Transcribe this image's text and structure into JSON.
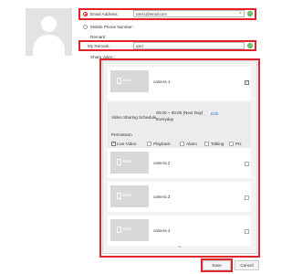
{
  "form": {
    "email_label": "Email Address:",
    "email_value": "user1@email.com",
    "phone_label": "Mobile Phone Number:",
    "remark_label": "Remark:",
    "my_remark_label": "My Remark:",
    "my_remark_value": "user",
    "share_label": "Share video :"
  },
  "cameras": [
    {
      "name": "camera 1",
      "checked": true
    },
    {
      "name": "camera 2",
      "checked": false
    },
    {
      "name": "camera 3",
      "checked": false
    },
    {
      "name": "camera 4",
      "checked": false
    }
  ],
  "thumb_text": "EZVIZ",
  "schedule": {
    "label": "Video Sharing Schedule",
    "time": "00:00 ~ 00:00 (Next Day)",
    "repeat": "Everyday",
    "edit": "Edit",
    "permission_label": "Permission",
    "permissions": [
      {
        "label": "Live Video",
        "checked": true
      },
      {
        "label": "Playback",
        "checked": false
      },
      {
        "label": "Alarm",
        "checked": false
      },
      {
        "label": "Talking",
        "checked": false
      },
      {
        "label": "Ptz",
        "checked": false
      }
    ]
  },
  "scroll_down": "⌄",
  "buttons": {
    "save": "Save",
    "cancel": "Cancel"
  },
  "colors": {
    "highlight": "#e1232b",
    "accent": "#2a7fd4",
    "ok": "#5cb85c"
  }
}
